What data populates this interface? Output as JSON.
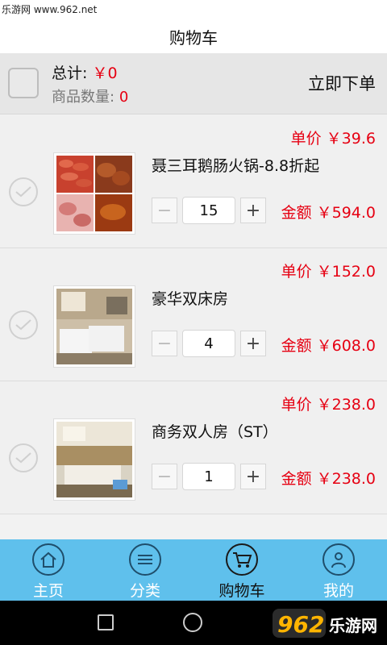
{
  "watermark": "乐游网 www.962.net",
  "title": "购物车",
  "summary": {
    "total_label": "总计:",
    "total_value": "￥0",
    "count_label": "商品数量:",
    "count_value": "0",
    "submit_label": "立即下单"
  },
  "items": [
    {
      "unit_price": "单价 ￥39.6",
      "name": "聂三耳鹅肠火锅-8.8折起",
      "quantity": "15",
      "amount": "金额 ￥594.0",
      "image": "hotpot-food-photo"
    },
    {
      "unit_price": "单价 ￥152.0",
      "name": "豪华双床房",
      "quantity": "4",
      "amount": "金额 ￥608.0",
      "image": "twin-room-photo"
    },
    {
      "unit_price": "单价 ￥238.0",
      "name": "商务双人房（ST）",
      "quantity": "1",
      "amount": "金额 ￥238.0",
      "image": "business-room-photo"
    }
  ],
  "stepper": {
    "minus": "−",
    "plus": "+"
  },
  "tabs": [
    {
      "label": "主页",
      "icon": "home-icon"
    },
    {
      "label": "分类",
      "icon": "list-icon"
    },
    {
      "label": "购物车",
      "icon": "cart-icon",
      "active": true
    },
    {
      "label": "我的",
      "icon": "user-icon"
    }
  ],
  "logo": {
    "number": "962",
    "text": "乐游网"
  },
  "colors": {
    "accent": "#e60012",
    "tabbar": "#5fc0ec"
  }
}
